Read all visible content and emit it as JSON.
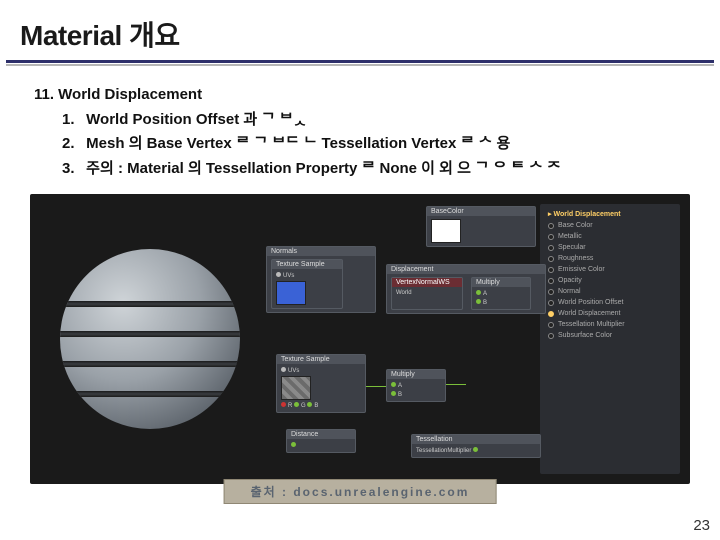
{
  "title": "Material 개요",
  "list": {
    "n11": "11.",
    "heading": "World Displacement",
    "items": [
      {
        "n": "1.",
        "prefix": "World Position Offset",
        "tail": "과 ᄀ ᄇᆺ"
      },
      {
        "n": "2.",
        "prefix": "Mesh",
        "mid1": "의 Base Vertex",
        "mid2": "ᄅ ᄀ ᄇᄃ ᄂ Tessellation Vertex",
        "tail": "ᄅ ᄉ 용"
      },
      {
        "n": "3.",
        "prefix": "주의 : Material",
        "mid1": "의 Tessellation Property",
        "mid2": "ᄅ None 이 외",
        "tail": "으 ᄀ ᄋ ᄐ ᄉ ᄌ"
      }
    ]
  },
  "props": {
    "title": "World Displacement",
    "rows": [
      "Base Color",
      "Metallic",
      "Specular",
      "Roughness",
      "Emissive Color",
      "Opacity",
      "Normal",
      "World Position Offset",
      "World Displacement",
      "Tessellation Multiplier",
      "Subsurface Color"
    ]
  },
  "nodes": {
    "basecolor": "BaseColor",
    "normals": "Normals",
    "texsample": "Texture Sample",
    "vertexhi": "VertexNormalWS",
    "displacement": "Displacement",
    "texsample2": "Texture Sample",
    "multiply": "Multiply",
    "multiply2": "Multiply",
    "distance": "Distance",
    "tessellation": "Tessellation"
  },
  "credit": "출처 : docs.unrealengine.com",
  "page": "23"
}
